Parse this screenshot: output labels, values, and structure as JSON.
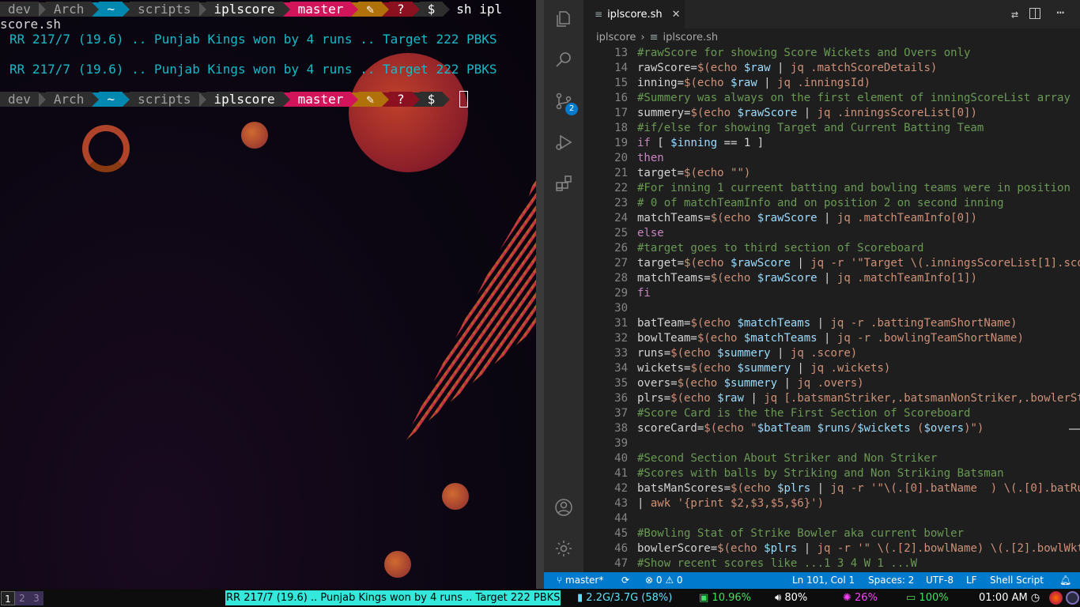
{
  "terminal": {
    "prompt_segments": [
      {
        "text": "dev",
        "bg": "#2e2e2e",
        "fg": "#a0a0a0"
      },
      {
        "text": "Arch",
        "bg": "#2e2e2e",
        "fg": "#a0a0a0"
      },
      {
        "text": "~",
        "bg": "#0088b0",
        "fg": "#ffffff"
      },
      {
        "text": "scripts",
        "bg": "#2e2e2e",
        "fg": "#a0a0a0"
      },
      {
        "text": "iplscore",
        "bg": "#2e2e2e",
        "fg": "#ffffff"
      },
      {
        "text": "master",
        "bg": "#d2145a",
        "fg": "#ffffff"
      },
      {
        "text": "✎",
        "bg": "#b0700a",
        "fg": "#ffffff"
      },
      {
        "text": "?",
        "bg": "#8b1020",
        "fg": "#ffffff"
      },
      {
        "text": "$",
        "bg": "#2e2e2e",
        "fg": "#ffffff"
      }
    ],
    "command_start": "sh ipl",
    "command_end": "score.sh",
    "output_1": "RR 217/7 (19.6) .. Punjab Kings won by 4 runs .. Target 222 PBKS",
    "output_2": "RR 217/7 (19.6) .. Punjab Kings won by 4 runs .. Target 222 PBKS"
  },
  "editor": {
    "tab_label": "iplscore.sh",
    "breadcrumb_folder": "iplscore",
    "breadcrumb_file": "iplscore.sh",
    "scm_badge": "2",
    "lines": [
      {
        "n": "13",
        "t": [
          [
            "cm",
            "#rawScore for showing Score Wickets and Overs only"
          ]
        ]
      },
      {
        "n": "14",
        "t": [
          [
            "df",
            "rawScore="
          ],
          [
            "st",
            "$(echo "
          ],
          [
            "vr",
            "$raw"
          ],
          [
            "df",
            " | "
          ],
          [
            "st",
            "jq .matchScoreDetails)"
          ]
        ]
      },
      {
        "n": "15",
        "t": [
          [
            "df",
            "inning="
          ],
          [
            "st",
            "$(echo "
          ],
          [
            "vr",
            "$raw"
          ],
          [
            "df",
            " | "
          ],
          [
            "st",
            "jq .inningsId)"
          ]
        ]
      },
      {
        "n": "16",
        "t": [
          [
            "cm",
            "#Summery was always on the first element of inningScoreList array"
          ]
        ]
      },
      {
        "n": "17",
        "t": [
          [
            "df",
            "summery="
          ],
          [
            "st",
            "$(echo "
          ],
          [
            "vr",
            "$rawScore"
          ],
          [
            "df",
            " | "
          ],
          [
            "st",
            "jq .inningsScoreList[0])"
          ]
        ]
      },
      {
        "n": "18",
        "t": [
          [
            "cm",
            "#if/else for showing Target and Current Batting Team"
          ]
        ]
      },
      {
        "n": "19",
        "t": [
          [
            "kw",
            "if"
          ],
          [
            "df",
            " [ "
          ],
          [
            "vr",
            "$inning"
          ],
          [
            "df",
            " == 1 ]"
          ]
        ]
      },
      {
        "n": "20",
        "t": [
          [
            "kw",
            "then"
          ]
        ]
      },
      {
        "n": "21",
        "t": [
          [
            "df",
            "target="
          ],
          [
            "st",
            "$(echo \"\")"
          ]
        ]
      },
      {
        "n": "22",
        "t": [
          [
            "cm",
            "#For inning 1 curreent batting and bowling teams were in position"
          ]
        ]
      },
      {
        "n": "23",
        "t": [
          [
            "cm",
            "# 0 of matchTeamInfo and on position 2 on second inning"
          ]
        ]
      },
      {
        "n": "24",
        "t": [
          [
            "df",
            "matchTeams="
          ],
          [
            "st",
            "$(echo "
          ],
          [
            "vr",
            "$rawScore"
          ],
          [
            "df",
            " | "
          ],
          [
            "st",
            "jq .matchTeamInfo[0])"
          ]
        ]
      },
      {
        "n": "25",
        "t": [
          [
            "kw",
            "else"
          ]
        ]
      },
      {
        "n": "26",
        "t": [
          [
            "cm",
            "#target goes to third section of Scoreboard"
          ]
        ]
      },
      {
        "n": "27",
        "t": [
          [
            "df",
            "target="
          ],
          [
            "st",
            "$(echo "
          ],
          [
            "vr",
            "$rawScore"
          ],
          [
            "df",
            " | "
          ],
          [
            "st",
            "jq -r '\"Target \\(.inningsScoreList[1].sco"
          ]
        ]
      },
      {
        "n": "28",
        "t": [
          [
            "df",
            "matchTeams="
          ],
          [
            "st",
            "$(echo "
          ],
          [
            "vr",
            "$rawScore"
          ],
          [
            "df",
            " | "
          ],
          [
            "st",
            "jq .matchTeamInfo[1])"
          ]
        ]
      },
      {
        "n": "29",
        "t": [
          [
            "kw",
            "fi"
          ]
        ]
      },
      {
        "n": "30",
        "t": []
      },
      {
        "n": "31",
        "t": [
          [
            "df",
            "batTeam="
          ],
          [
            "st",
            "$(echo "
          ],
          [
            "vr",
            "$matchTeams"
          ],
          [
            "df",
            " | "
          ],
          [
            "st",
            "jq -r .battingTeamShortName)"
          ]
        ]
      },
      {
        "n": "32",
        "t": [
          [
            "df",
            "bowlTeam="
          ],
          [
            "st",
            "$(echo "
          ],
          [
            "vr",
            "$matchTeams"
          ],
          [
            "df",
            " | "
          ],
          [
            "st",
            "jq -r .bowlingTeamShortName)"
          ]
        ]
      },
      {
        "n": "33",
        "t": [
          [
            "df",
            "runs="
          ],
          [
            "st",
            "$(echo "
          ],
          [
            "vr",
            "$summery"
          ],
          [
            "df",
            " | "
          ],
          [
            "st",
            "jq .score)"
          ]
        ]
      },
      {
        "n": "34",
        "t": [
          [
            "df",
            "wickets="
          ],
          [
            "st",
            "$(echo "
          ],
          [
            "vr",
            "$summery"
          ],
          [
            "df",
            " | "
          ],
          [
            "st",
            "jq .wickets)"
          ]
        ]
      },
      {
        "n": "35",
        "t": [
          [
            "df",
            "overs="
          ],
          [
            "st",
            "$(echo "
          ],
          [
            "vr",
            "$summery"
          ],
          [
            "df",
            " | "
          ],
          [
            "st",
            "jq .overs)"
          ]
        ]
      },
      {
        "n": "36",
        "t": [
          [
            "df",
            "plrs="
          ],
          [
            "st",
            "$(echo "
          ],
          [
            "vr",
            "$raw"
          ],
          [
            "df",
            " | "
          ],
          [
            "st",
            "jq [.batsmanStriker,.batsmanNonStriker,.bowlerSt"
          ]
        ]
      },
      {
        "n": "37",
        "t": [
          [
            "cm",
            "#Score Card is the the First Section of Scoreboard"
          ]
        ]
      },
      {
        "n": "38",
        "t": [
          [
            "df",
            "scoreCard="
          ],
          [
            "st",
            "$(echo \""
          ],
          [
            "vr",
            "$batTeam $runs"
          ],
          [
            "st",
            "/"
          ],
          [
            "vr",
            "$wickets"
          ],
          [
            "st",
            " ("
          ],
          [
            "vr",
            "$overs"
          ],
          [
            "st",
            ")\")"
          ]
        ]
      },
      {
        "n": "39",
        "t": []
      },
      {
        "n": "40",
        "t": [
          [
            "cm",
            "#Second Section About Striker and Non Striker"
          ]
        ]
      },
      {
        "n": "41",
        "t": [
          [
            "cm",
            "#Scores with balls by Striking and Non Striking Batsman"
          ]
        ]
      },
      {
        "n": "42",
        "t": [
          [
            "df",
            "batsManScores="
          ],
          [
            "st",
            "$(echo "
          ],
          [
            "vr",
            "$plrs"
          ],
          [
            "df",
            " | "
          ],
          [
            "st",
            "jq -r '\"\\(.[0].batName  ) \\(.[0].batRu"
          ]
        ]
      },
      {
        "n": "43",
        "t": [
          [
            "df",
            "| "
          ],
          [
            "st",
            "awk '{print $2,$3,$5,$6}')"
          ]
        ]
      },
      {
        "n": "44",
        "t": []
      },
      {
        "n": "45",
        "t": [
          [
            "cm",
            "#Bowling Stat of Strike Bowler aka current bowler"
          ]
        ]
      },
      {
        "n": "46",
        "t": [
          [
            "df",
            "bowlerScore="
          ],
          [
            "st",
            "$(echo "
          ],
          [
            "vr",
            "$plrs"
          ],
          [
            "df",
            " | "
          ],
          [
            "st",
            "jq -r '\" \\(.[2].bowlName) \\(.[2].bowlWkt"
          ]
        ]
      },
      {
        "n": "47",
        "t": [
          [
            "cm",
            "#Show recent scores like ...1 3 4 W 1 ...W"
          ]
        ]
      }
    ]
  },
  "statusbar": {
    "branch": "master*",
    "errors": "0",
    "warnings": "0",
    "cursor": "Ln 101, Col 1",
    "spaces": "Spaces: 2",
    "encoding": "UTF-8",
    "eol": "LF",
    "language": "Shell Script"
  },
  "wm": {
    "workspaces": [
      "1",
      "2",
      "3"
    ],
    "score_ticker": "RR 217/7 (19.6) .. Punjab Kings won by 4 runs .. Target 222 PBKS",
    "memory": "2.2G/3.7G (58%)",
    "cpu": "10.96%",
    "volume": "80%",
    "brightness": "26%",
    "battery": "100%",
    "clock": "01:00 AM"
  }
}
